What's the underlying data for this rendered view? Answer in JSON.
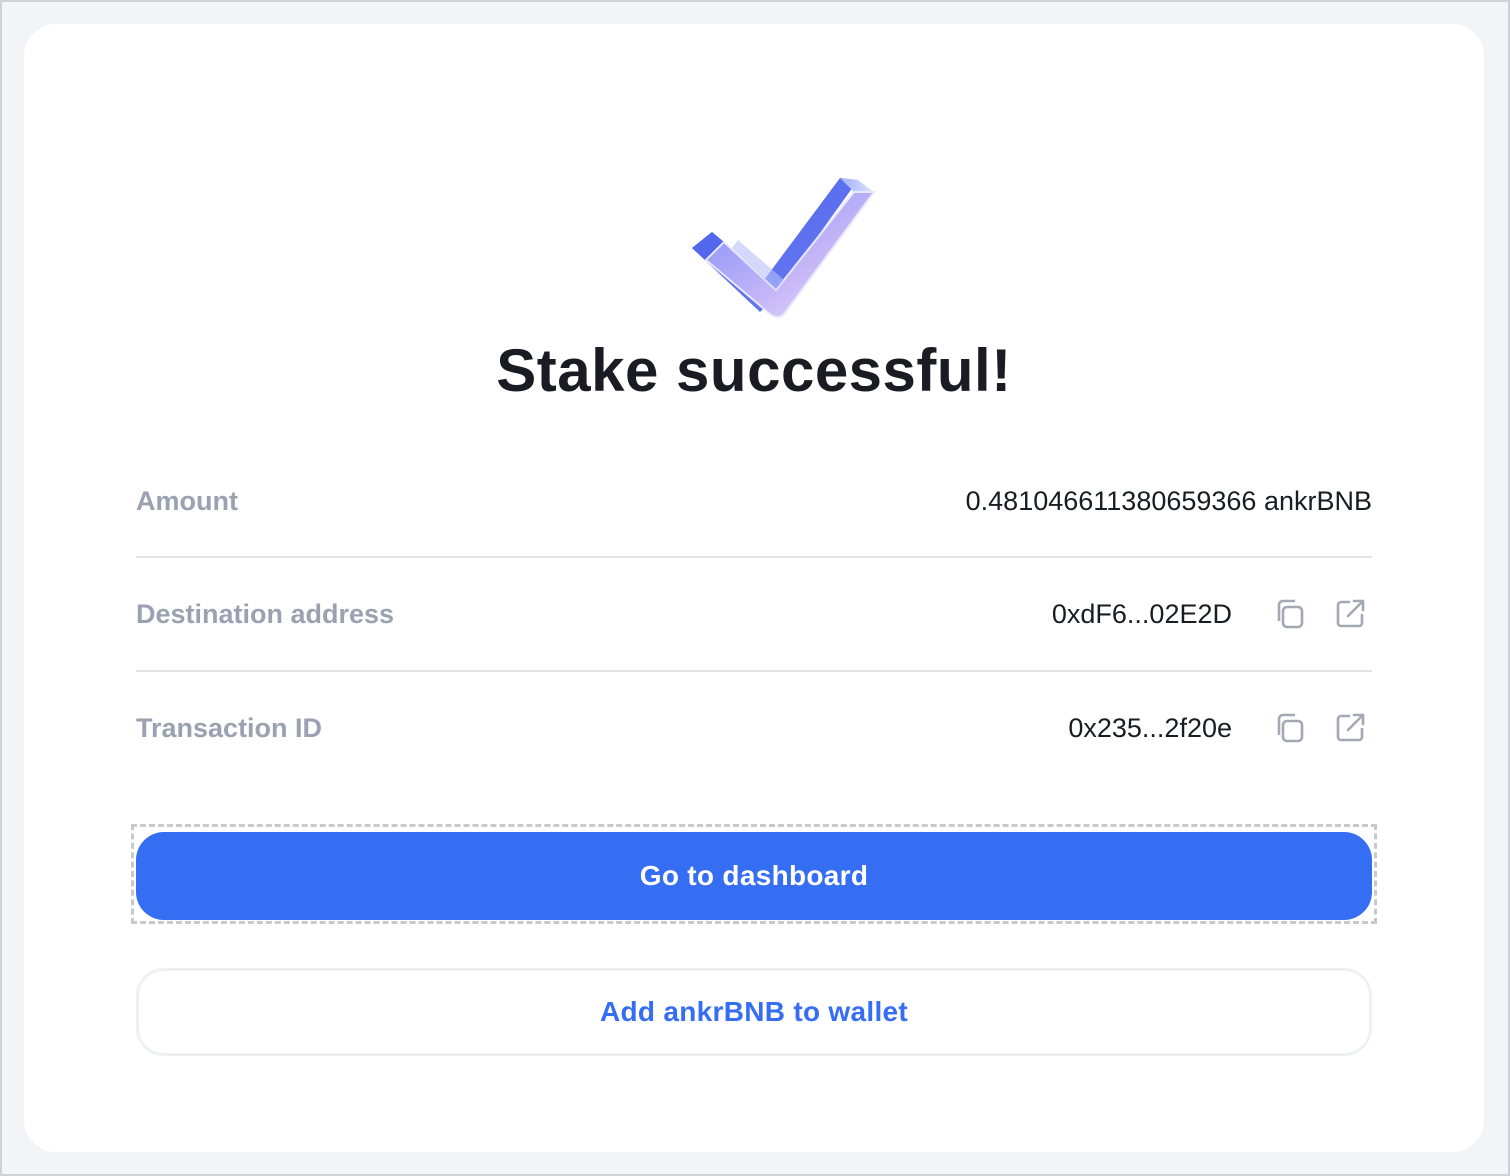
{
  "page": {
    "title": "Stake successful!"
  },
  "rows": [
    {
      "label": "Amount",
      "value": "0.481046611380659366 ankrBNB"
    },
    {
      "label": "Destination address",
      "value": "0xdF6...02E2D"
    },
    {
      "label": "Transaction ID",
      "value": "0x235...2f20e"
    }
  ],
  "actions": {
    "primary_label": "Go to dashboard",
    "secondary_label": "Add ankrBNB to wallet"
  },
  "icons": {
    "success": "checkmark-3d-icon",
    "copy": "copy-icon",
    "external": "external-link-icon"
  },
  "colors": {
    "accent": "#356df3",
    "label": "#9aa1b1",
    "text": "#1a1c23"
  }
}
